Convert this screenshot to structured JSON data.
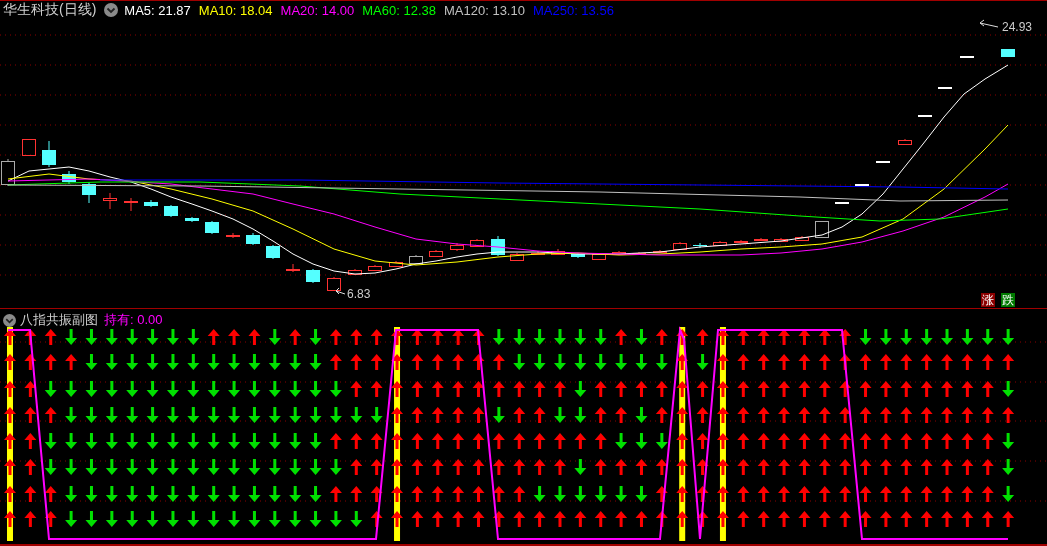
{
  "main_chart": {
    "title": "华生科技(日线)",
    "ma_values": [
      {
        "text": "MA5: 21.87",
        "color": "#ffffff"
      },
      {
        "text": "MA10: 18.04",
        "color": "#ffff00"
      },
      {
        "text": "MA20: 14.00",
        "color": "#ff00ff"
      },
      {
        "text": "MA60: 12.38",
        "color": "#00ff00"
      },
      {
        "text": "MA120: 13.10",
        "color": "#c0c0c0"
      },
      {
        "text": "MA250: 13.56",
        "color": "#0000ff"
      }
    ],
    "high_label": "24.93",
    "low_label": "6.83",
    "rise_badge": "涨",
    "fall_badge": "跌"
  },
  "sub_chart": {
    "title": "八指共振副图",
    "holding": "持有: 0.00"
  }
}
